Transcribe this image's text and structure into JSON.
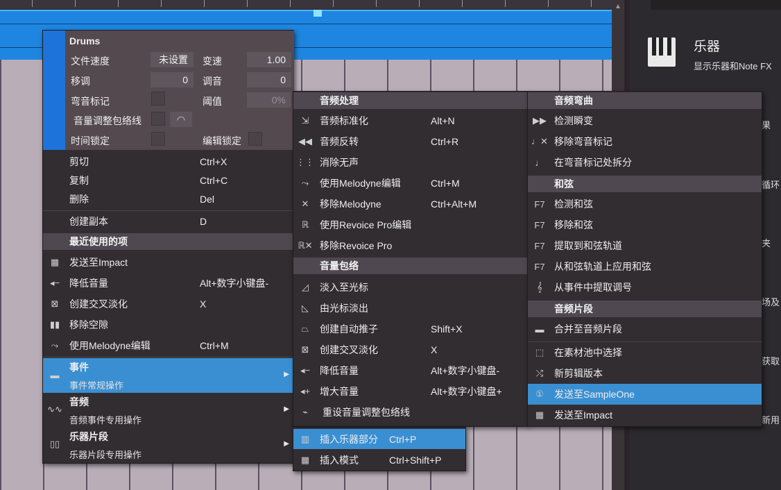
{
  "inspector": {
    "event_name": "Drums",
    "file_tempo_label": "文件速度",
    "file_tempo_value": "未设置",
    "speed_label": "变速",
    "speed_value": "1.00",
    "transpose_label": "移调",
    "transpose_value": "0",
    "tune_label": "调音",
    "tune_value": "0",
    "bend_markers_label": "弯音标记",
    "threshold_label": "阈值",
    "threshold_value": "0%",
    "volume_envelope_label": "音量调整包络线",
    "time_lock_label": "时间锁定",
    "edit_lock_label": "编辑锁定"
  },
  "left_menu": {
    "cut": {
      "label": "剪切",
      "shortcut": "Ctrl+X"
    },
    "copy": {
      "label": "复制",
      "shortcut": "Ctrl+C"
    },
    "delete": {
      "label": "删除",
      "shortcut": "Del"
    },
    "duplicate": {
      "label": "创建副本",
      "shortcut": "D"
    },
    "recent_header": "最近使用的项",
    "recent": [
      {
        "label": "发送至Impact",
        "shortcut": ""
      },
      {
        "label": "降低音量",
        "shortcut": "Alt+数字小键盘-"
      },
      {
        "label": "创建交叉淡化",
        "shortcut": "X"
      },
      {
        "label": "移除空隙",
        "shortcut": ""
      },
      {
        "label": "使用Melodyne编辑",
        "shortcut": "Ctrl+M"
      }
    ],
    "event_group": {
      "label": "事件",
      "sub": "事件常规操作"
    },
    "audio_group": {
      "label": "音频",
      "sub": "音频事件专用操作"
    },
    "instrument_group": {
      "label": "乐器片段",
      "sub": "乐器片段专用操作"
    }
  },
  "mid_menu": {
    "audio_processing_header": "音频处理",
    "audio_processing": [
      {
        "label": "音频标准化",
        "shortcut": "Alt+N"
      },
      {
        "label": "音频反转",
        "shortcut": "Ctrl+R"
      },
      {
        "label": "消除无声",
        "shortcut": ""
      },
      {
        "label": "使用Melodyne编辑",
        "shortcut": "Ctrl+M"
      },
      {
        "label": "移除Melodyne",
        "shortcut": "Ctrl+Alt+M"
      },
      {
        "label": "使用Revoice Pro编辑",
        "shortcut": ""
      },
      {
        "label": "移除Revoice Pro",
        "shortcut": ""
      }
    ],
    "volume_envelope_header": "音量包络",
    "volume_envelope": [
      {
        "label": "淡入至光标",
        "shortcut": ""
      },
      {
        "label": "由光标淡出",
        "shortcut": ""
      },
      {
        "label": "创建自动推子",
        "shortcut": "Shift+X"
      },
      {
        "label": "创建交叉淡化",
        "shortcut": "X"
      },
      {
        "label": "降低音量",
        "shortcut": "Alt+数字小键盘-"
      },
      {
        "label": "增大音量",
        "shortcut": "Alt+数字小键盘+"
      },
      {
        "label": "重设音量调整包络线",
        "shortcut": ""
      }
    ]
  },
  "sub_menu": {
    "insert_part": {
      "label": "插入乐器部分",
      "shortcut": "Ctrl+P"
    },
    "insert_pattern": {
      "label": "插入模式",
      "shortcut": "Ctrl+Shift+P"
    }
  },
  "right_menu": {
    "audio_bend_header": "音频弯曲",
    "audio_bend": [
      {
        "label": "检测瞬变"
      },
      {
        "label": "移除弯音标记"
      },
      {
        "label": "在弯音标记处拆分"
      }
    ],
    "chords_header": "和弦",
    "chords": [
      {
        "label": "检测和弦"
      },
      {
        "label": "移除和弦"
      },
      {
        "label": "提取到和弦轨道"
      },
      {
        "label": "从和弦轨道上应用和弦"
      },
      {
        "label": "从事件中提取调号"
      }
    ],
    "audio_part_header": "音频片段",
    "merge_audio_part": "合并至音频片段",
    "select_in_pool": "在素材池中选择",
    "new_edit_version": "新剪辑版本",
    "send_to_sampleone": "发送至SampleOne",
    "send_to_impact": "发送至Impact"
  },
  "browser_panel": {
    "title": "乐器",
    "subtitle": "显示乐器和Note FX",
    "edge_texts": [
      "果",
      "循环",
      "夹",
      "场及",
      "获取",
      "新用"
    ]
  },
  "colors": {
    "menu_bg": "#322d31",
    "section_bg": "#4f4850",
    "highlight": "#3a8fd2",
    "event_blue": "#1e86e0"
  }
}
